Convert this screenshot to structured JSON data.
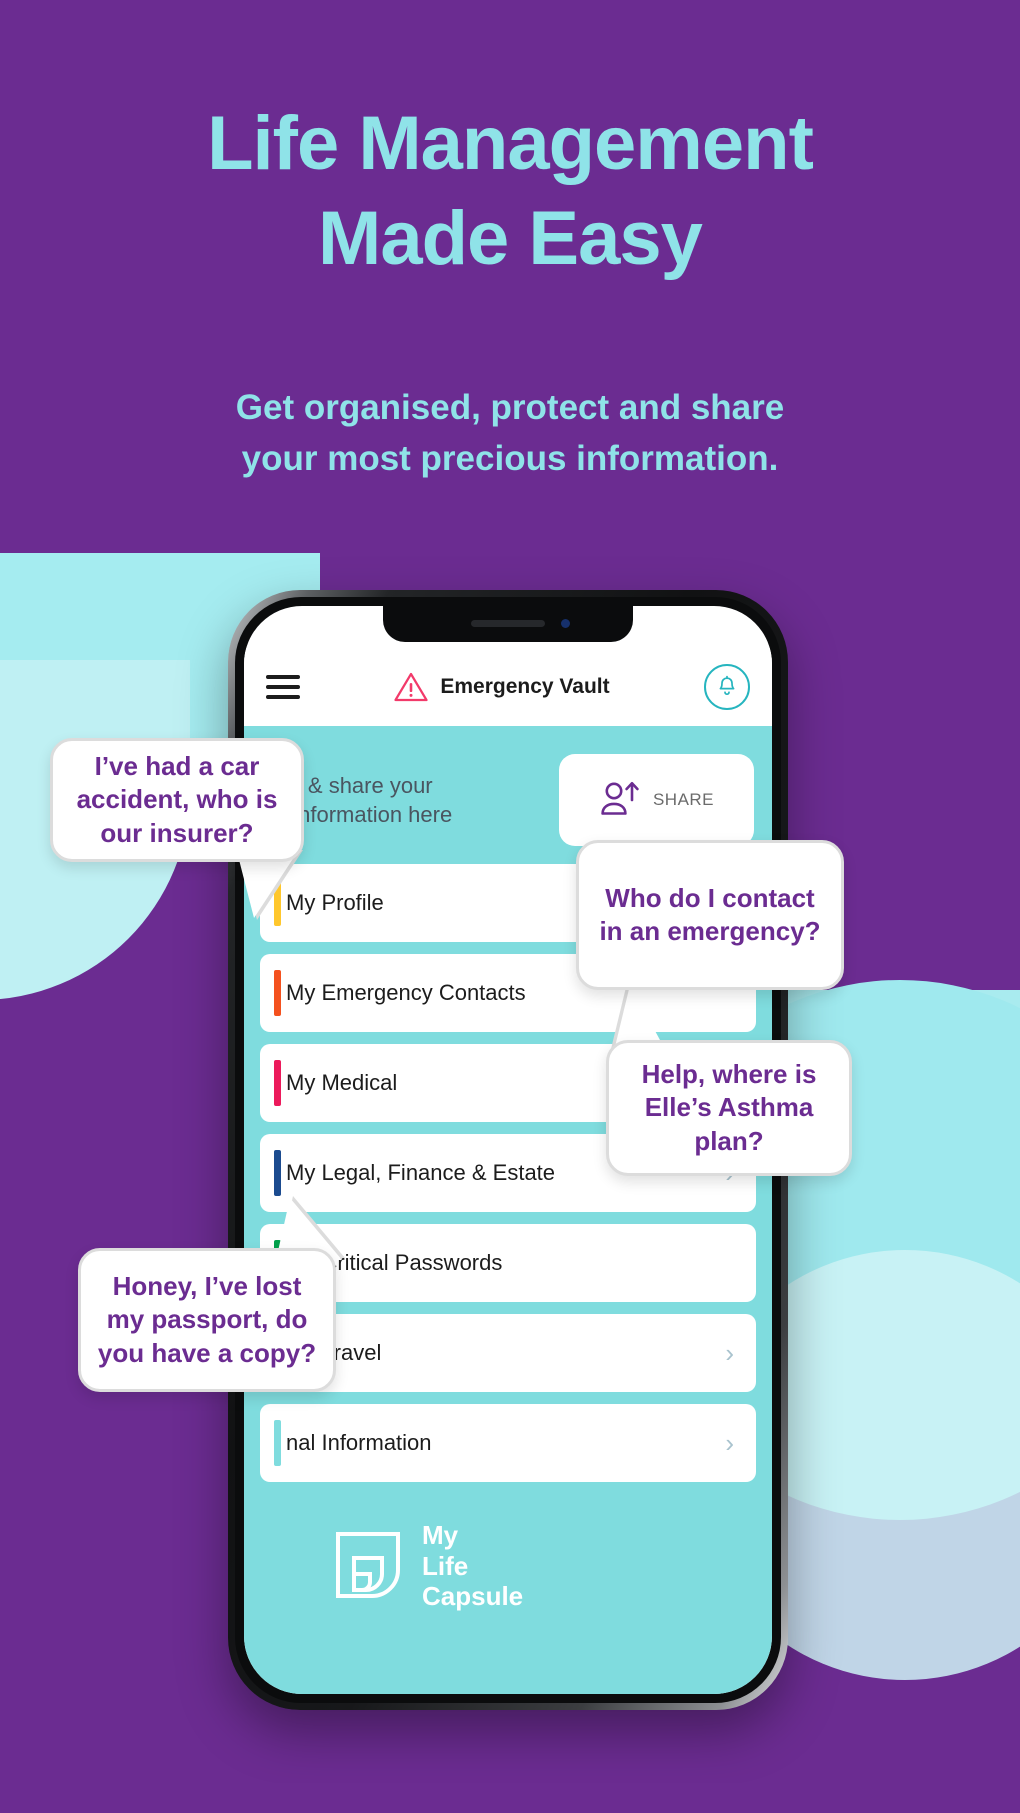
{
  "theme": {
    "background_purple": "#6B2C91",
    "accent_teal": "#8FE3E8",
    "app_teal": "#7FDCDE",
    "bubble_text_purple": "#6B2C91"
  },
  "hero": {
    "headline_line1": "Life Management",
    "headline_line2": "Made Easy",
    "subhead_line1": "Get organised, protect and share",
    "subhead_line2": "your most precious information."
  },
  "phone": {
    "header": {
      "menu_icon": "hamburger-icon",
      "warning_icon": "warning-triangle-icon",
      "title": "Emergency Vault",
      "bell_icon": "bell-icon"
    },
    "banner": {
      "text_line1": "ure & share your",
      "text_line2": "al information here",
      "share_icon": "person-share-icon",
      "share_label": "SHARE"
    },
    "vault_items": [
      {
        "label": "My Profile",
        "color": "#FFC72C",
        "chevron": ""
      },
      {
        "label": "My Emergency Contacts",
        "color": "#F4511E",
        "chevron": ""
      },
      {
        "label": "My Medical",
        "color": "#EC1A5B",
        "chevron": "›"
      },
      {
        "label": "My Legal, Finance & Estate",
        "color": "#1B4B8F",
        "chevron": "›"
      },
      {
        "label": "My Critical Passwords",
        "color": "#00A14B",
        "chevron": ""
      },
      {
        "label": "My Travel",
        "color": "#2F80ED",
        "chevron": "›"
      },
      {
        "label": "nal Information",
        "color": "#7FDCDE",
        "chevron": "›"
      }
    ],
    "brand": {
      "mark_icon": "my-life-capsule-leaf-icon",
      "word1": "My",
      "word2": "Life",
      "word3": "Capsule"
    }
  },
  "bubbles": [
    {
      "id": "insurer",
      "text": "I’ve had a car accident, who is our insurer?"
    },
    {
      "id": "contact",
      "text": "Who do I contact in an emergency?"
    },
    {
      "id": "asthma",
      "text": "Help, where is Elle’s Asthma plan?"
    },
    {
      "id": "passport",
      "text": "Honey, I’ve lost my passport, do you have a copy?"
    }
  ]
}
